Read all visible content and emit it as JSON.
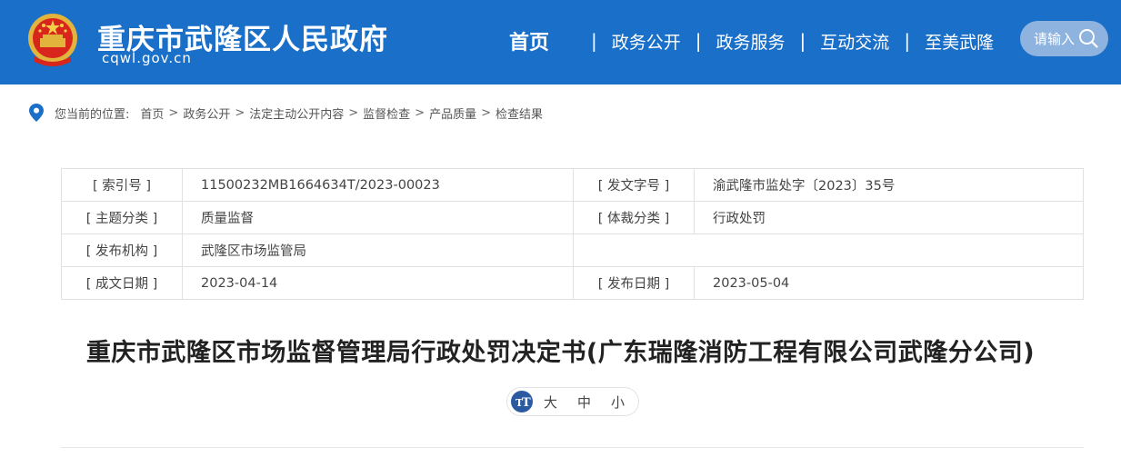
{
  "header": {
    "site_title": "重庆市武隆区人民政府",
    "site_domain": "cqwl.gov.cn",
    "emblem_icon": "national-emblem-icon",
    "bg_color": "#1a6fc8",
    "nav": [
      {
        "label": "首页"
      },
      {
        "label": "政务公开"
      },
      {
        "label": "政务服务"
      },
      {
        "label": "互动交流"
      },
      {
        "label": "至美武隆"
      }
    ],
    "nav_separator": "|",
    "search": {
      "placeholder": "请输入",
      "icon": "search-icon"
    }
  },
  "breadcrumb": {
    "icon": "location-pin-icon",
    "label": "您当前的位置:",
    "separator": ">",
    "items": [
      "首页",
      "政务公开",
      "法定主动公开内容",
      "监督检查",
      "产品质量",
      "检查结果"
    ]
  },
  "meta": {
    "index_no_key": "[ 索引号 ]",
    "index_no": "11500232MB1664634T/2023-00023",
    "doc_no_key": "[ 发文字号 ]",
    "doc_no": "渝武隆市监处字〔2023〕35号",
    "topic_key": "[ 主题分类 ]",
    "topic": "质量监督",
    "genre_key": "[ 体裁分类 ]",
    "genre": "行政处罚",
    "publisher_key": "[ 发布机构 ]",
    "publisher": "武隆区市场监管局",
    "created_key": "[ 成文日期 ]",
    "created": "2023-04-14",
    "published_key": "[ 发布日期 ]",
    "published": "2023-05-04"
  },
  "article": {
    "title": "重庆市武隆区市场监督管理局行政处罚决定书(广东瑞隆消防工程有限公司武隆分公司)"
  },
  "font_size": {
    "icon": "text-size-icon",
    "options": [
      "大",
      "中",
      "小"
    ]
  }
}
